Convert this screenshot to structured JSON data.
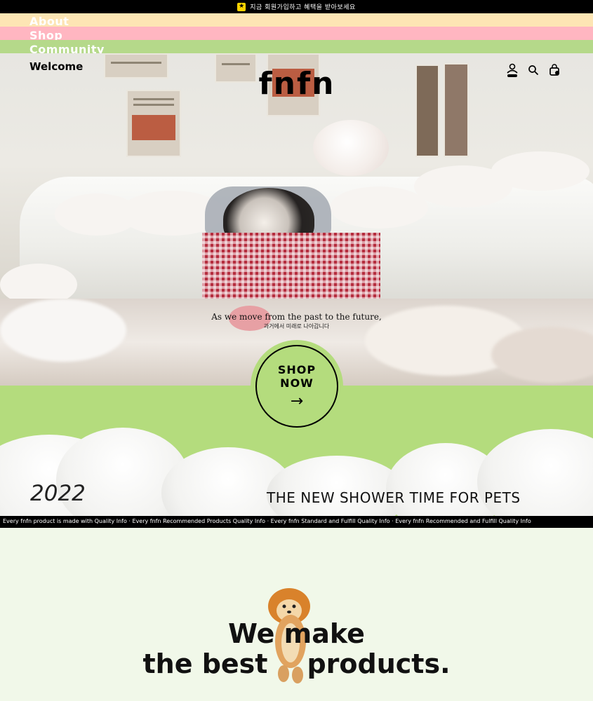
{
  "topbar": {
    "text": "지금 회원가입하고 혜택을 받아보세요"
  },
  "menu": {
    "items": [
      "About",
      "Shop",
      "Community"
    ],
    "welcome": "Welcome"
  },
  "brand": {
    "logo": "fnfn"
  },
  "hero": {
    "quote": "As we move from the past to the future,",
    "subquote": "과거에서 미래로 나아갑니다"
  },
  "cta": {
    "line1": "SHOP",
    "line2": "NOW",
    "arrow": "→"
  },
  "banner": {
    "year": "2022",
    "tagline": "THE NEW SHOWER TIME FOR PETS"
  },
  "ticker": {
    "text": "Every fnfn product is made with Quality Info · Every fnfn Recommended Products Quality Info · Every fnfn Standard and Fulfill Quality Info · Every fnfn Recommended and Fulfill Quality Info"
  },
  "headline": {
    "line1": "We make",
    "line2": "the best",
    "line3": "products."
  },
  "icons": [
    "user-icon",
    "search-icon",
    "cart-icon"
  ],
  "colors": {
    "peach": "#fde5b4",
    "pink": "#ffb6c1",
    "green": "#b4dc7d",
    "mint": "#f1f8e9",
    "black": "#000000"
  }
}
